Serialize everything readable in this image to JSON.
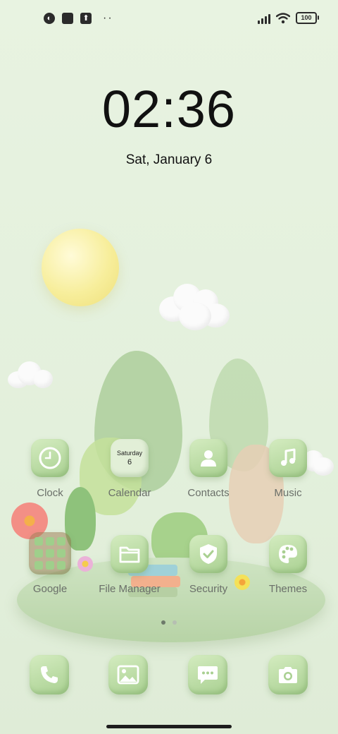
{
  "status_bar": {
    "battery": "100",
    "left_icons": [
      "camera-app-icon",
      "square-notification-icon",
      "upload-icon",
      "more-dots-icon"
    ],
    "right_icons": [
      "signal-icon",
      "wifi-icon",
      "battery-icon"
    ]
  },
  "lockscreen": {
    "time": "02:36",
    "date": "Sat, January 6"
  },
  "home_rows": [
    [
      {
        "label": "Clock",
        "icon": "clock-icon"
      },
      {
        "label": "Calendar",
        "icon": "calendar-icon",
        "widget_day": "Saturday",
        "widget_date": "6"
      },
      {
        "label": "Contacts",
        "icon": "contacts-icon"
      },
      {
        "label": "Music",
        "icon": "music-icon"
      }
    ],
    [
      {
        "label": "Google",
        "icon": "google-folder-icon"
      },
      {
        "label": "File Manager",
        "icon": "folder-icon"
      },
      {
        "label": "Security",
        "icon": "shield-icon"
      },
      {
        "label": "Themes",
        "icon": "palette-icon"
      }
    ]
  ],
  "dock": [
    {
      "icon": "phone-icon"
    },
    {
      "icon": "gallery-icon"
    },
    {
      "icon": "messages-icon"
    },
    {
      "icon": "camera-icon"
    }
  ],
  "pager": {
    "pages": 2,
    "current": 1
  },
  "colors": {
    "icon_green": "#a9d091",
    "background": "#e5f1de",
    "text_dark": "#111111",
    "label_gray": "#6a6f69"
  }
}
